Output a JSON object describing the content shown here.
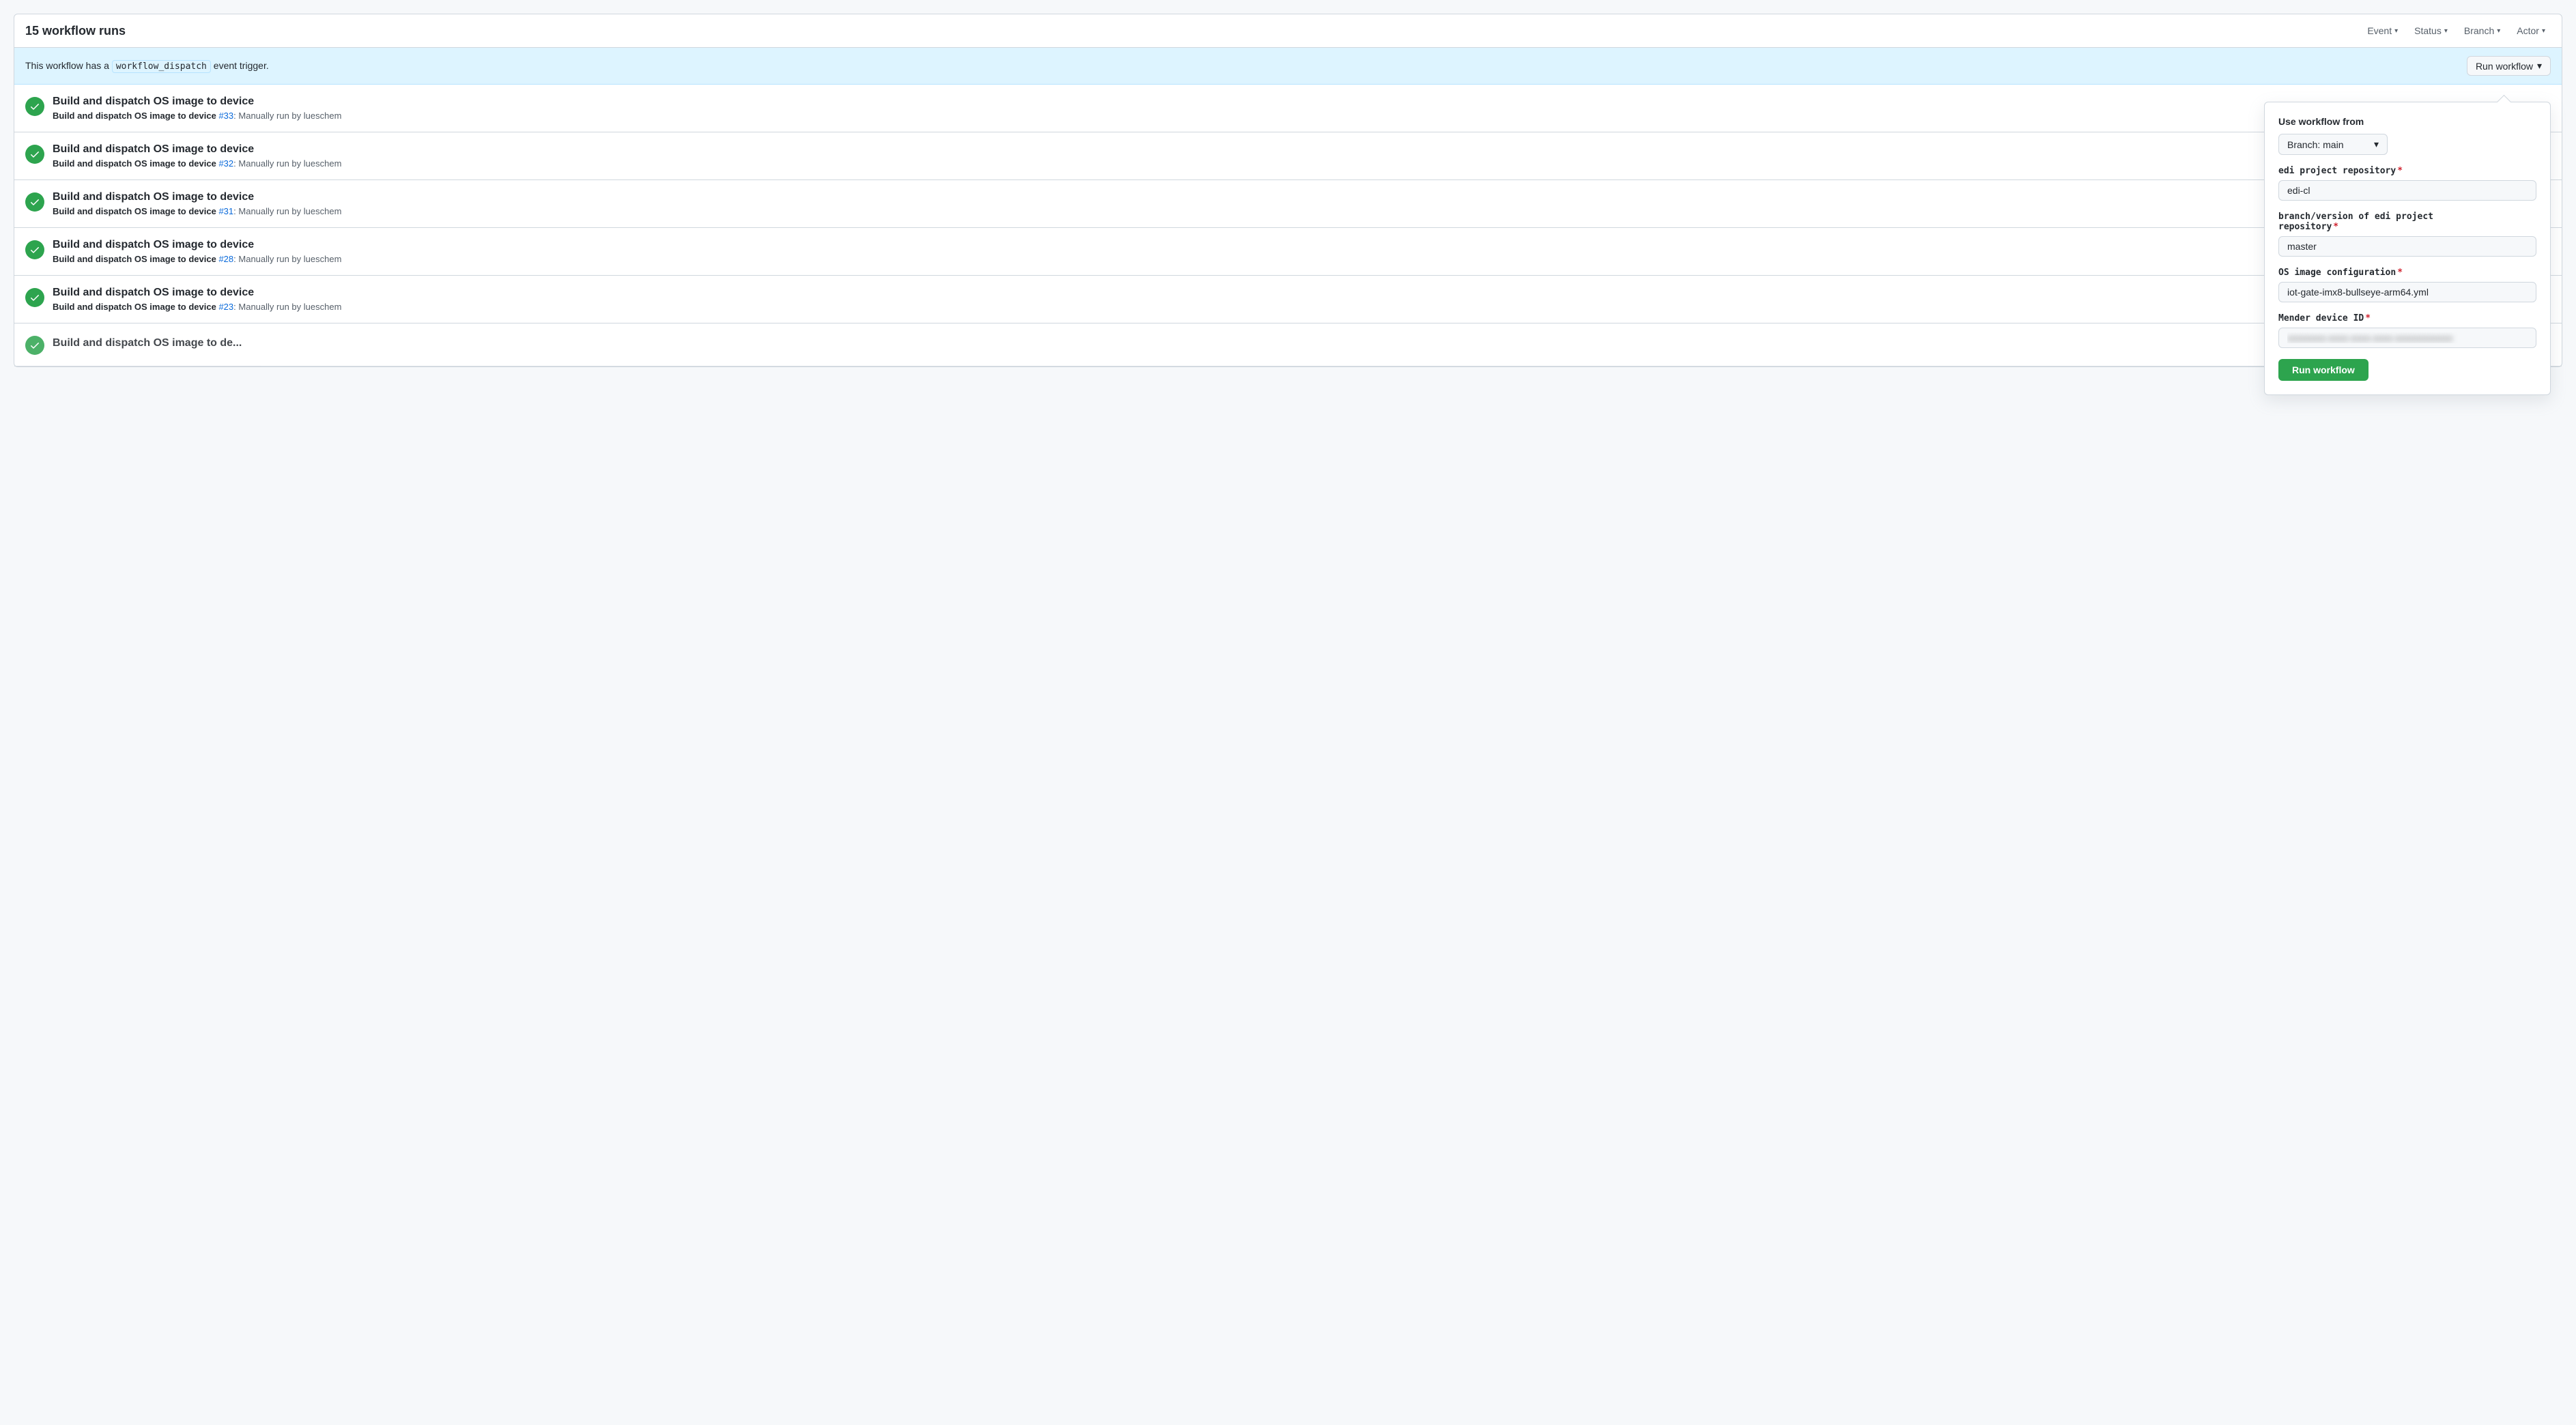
{
  "header": {
    "title": "15 workflow runs",
    "filters": [
      {
        "label": "Event",
        "id": "event"
      },
      {
        "label": "Status",
        "id": "status"
      },
      {
        "label": "Branch",
        "id": "branch"
      },
      {
        "label": "Actor",
        "id": "actor"
      }
    ]
  },
  "banner": {
    "text_prefix": "This workflow has a",
    "code": "workflow_dispatch",
    "text_suffix": "event trigger.",
    "run_button_label": "Run workflow"
  },
  "workflow_runs": [
    {
      "id": 1,
      "name": "Build and dispatch OS image to device",
      "sub_prefix": "Build and dispatch OS image to device",
      "run_number": "#33",
      "sub_suffix": ": Manually run by lueschem"
    },
    {
      "id": 2,
      "name": "Build and dispatch OS image to device",
      "sub_prefix": "Build and dispatch OS image to device",
      "run_number": "#32",
      "sub_suffix": ": Manually run by lueschem"
    },
    {
      "id": 3,
      "name": "Build and dispatch OS image to device",
      "sub_prefix": "Build and dispatch OS image to device",
      "run_number": "#31",
      "sub_suffix": ": Manually run by lueschem"
    },
    {
      "id": 4,
      "name": "Build and dispatch OS image to device",
      "sub_prefix": "Build and dispatch OS image to device",
      "run_number": "#28",
      "sub_suffix": ": Manually run by lueschem"
    },
    {
      "id": 5,
      "name": "Build and dispatch OS image to device",
      "sub_prefix": "Build and dispatch OS image to device",
      "run_number": "#23",
      "sub_suffix": ": Manually run by lueschem"
    }
  ],
  "partial_item": {
    "name": "Build and dispatch OS image to de..."
  },
  "dropdown": {
    "title": "Use workflow from",
    "branch_label": "Branch: main",
    "fields": [
      {
        "id": "edi_project_repository",
        "label": "edi project repository",
        "required": true,
        "value": "edi-cl",
        "placeholder": ""
      },
      {
        "id": "branch_version",
        "label": "branch/version of edi project\nrepository",
        "label_line1": "branch/version of edi project",
        "label_line2": "repository",
        "required": true,
        "value": "master",
        "placeholder": ""
      },
      {
        "id": "os_image_configuration",
        "label": "OS image configuration",
        "required": true,
        "value": "iot-gate-imx8-bullseye-arm64.yml",
        "placeholder": ""
      },
      {
        "id": "mender_device_id",
        "label": "Mender device ID",
        "required": true,
        "value": "••••••••-••••-••••-••••-••••••••••••",
        "placeholder": "",
        "blurred": true
      }
    ],
    "run_button_label": "Run workflow"
  }
}
